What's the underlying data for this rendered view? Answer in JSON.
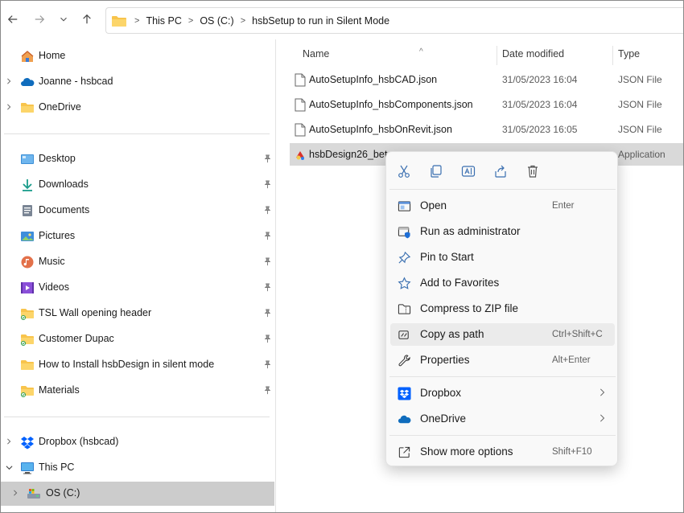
{
  "address_bar": {
    "breadcrumbs": [
      "This PC",
      "OS (C:)",
      "hsbSetup to run in Silent Mode"
    ]
  },
  "sidebar": {
    "top_items": [
      {
        "label": "Home",
        "icon": "home-icon"
      },
      {
        "label": "Joanne - hsbcad",
        "icon": "cloud-icon"
      },
      {
        "label": "OneDrive",
        "icon": "folder-icon"
      }
    ],
    "quick_access": [
      {
        "label": "Desktop",
        "icon": "desktop-icon"
      },
      {
        "label": "Downloads",
        "icon": "download-icon"
      },
      {
        "label": "Documents",
        "icon": "documents-icon"
      },
      {
        "label": "Pictures",
        "icon": "pictures-icon"
      },
      {
        "label": "Music",
        "icon": "music-icon"
      },
      {
        "label": "Videos",
        "icon": "videos-icon"
      },
      {
        "label": "TSL Wall opening header",
        "icon": "folder-icon"
      },
      {
        "label": "Customer Dupac",
        "icon": "folder-icon"
      },
      {
        "label": "How to Install hsbDesign in silent mode",
        "icon": "folder-icon"
      },
      {
        "label": "Materials",
        "icon": "folder-icon"
      }
    ],
    "bottom_items": [
      {
        "label": "Dropbox (hsbcad)",
        "icon": "dropbox-icon"
      },
      {
        "label": "This PC",
        "icon": "pc-icon"
      },
      {
        "label": "OS (C:)",
        "icon": "drive-icon"
      }
    ]
  },
  "file_list": {
    "columns": {
      "name": "Name",
      "date": "Date modified",
      "type": "Type"
    },
    "rows": [
      {
        "name": "AutoSetupInfo_hsbCAD.json",
        "date": "31/05/2023 16:04",
        "type": "JSON File"
      },
      {
        "name": "AutoSetupInfo_hsbComponents.json",
        "date": "31/05/2023 16:04",
        "type": "JSON File"
      },
      {
        "name": "AutoSetupInfo_hsbOnRevit.json",
        "date": "31/05/2023 16:05",
        "type": "JSON File"
      },
      {
        "name": "hsbDesign26_beta",
        "date": "",
        "type": "Application"
      }
    ]
  },
  "context_menu": {
    "quick_actions": [
      "cut-icon",
      "copy-icon",
      "rename-icon",
      "share-icon",
      "delete-icon"
    ],
    "items": [
      {
        "label": "Open",
        "shortcut": "Enter"
      },
      {
        "label": "Run as administrator",
        "shortcut": ""
      },
      {
        "label": "Pin to Start",
        "shortcut": ""
      },
      {
        "label": "Add to Favorites",
        "shortcut": ""
      },
      {
        "label": "Compress to ZIP file",
        "shortcut": ""
      },
      {
        "label": "Copy as path",
        "shortcut": "Ctrl+Shift+C"
      },
      {
        "label": "Properties",
        "shortcut": "Alt+Enter"
      },
      {
        "label": "Dropbox",
        "shortcut": ""
      },
      {
        "label": "OneDrive",
        "shortcut": ""
      },
      {
        "label": "Show more options",
        "shortcut": "Shift+F10"
      }
    ]
  },
  "colors": {
    "folder": "#f8c44c",
    "onedrive": "#0f6cbd",
    "dropbox": "#0061fe",
    "accent": "#0067c0"
  }
}
